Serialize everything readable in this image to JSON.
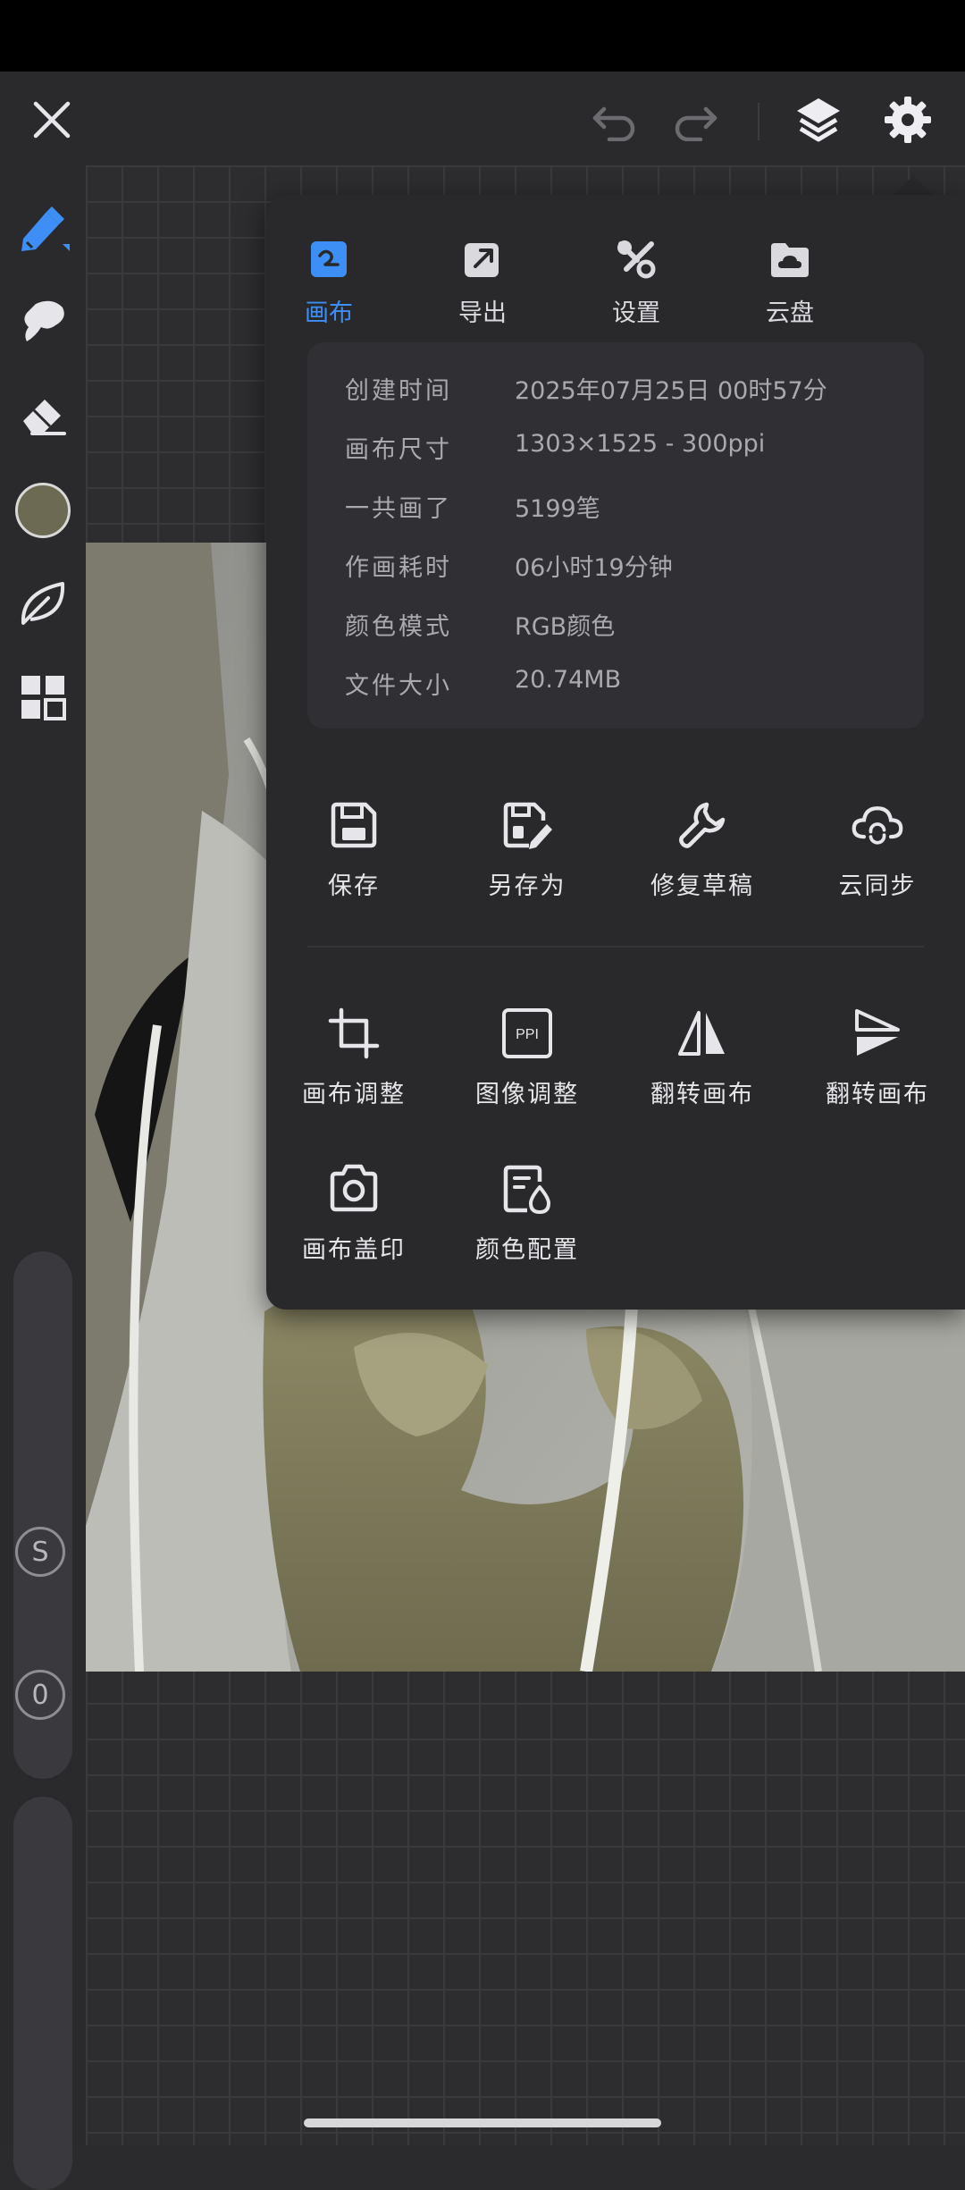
{
  "accent_color": "#3d8ff5",
  "toolbar": {
    "close_icon": "close-icon",
    "undo_icon": "undo-icon",
    "redo_icon": "redo-icon",
    "layers_icon": "layers-icon",
    "settings_icon": "gear-icon"
  },
  "left_rail": {
    "tools": [
      "pen-icon",
      "smudge-icon",
      "eraser-icon",
      "color-swatch",
      "leaf-icon",
      "grid-icon"
    ],
    "swatch_color": "#6c6a52",
    "size_slider_label": "S",
    "opacity_slider_label": "0"
  },
  "panel": {
    "tabs": [
      {
        "label": "画布",
        "icon": "canvas-tab-icon",
        "active": true
      },
      {
        "label": "导出",
        "icon": "export-icon",
        "active": false
      },
      {
        "label": "设置",
        "icon": "settings-tools-icon",
        "active": false
      },
      {
        "label": "云盘",
        "icon": "cloud-folder-icon",
        "active": false
      }
    ],
    "info": [
      {
        "key": "创建时间",
        "value": "2025年07月25日 00时57分"
      },
      {
        "key": "画布尺寸",
        "value": "1303×1525 - 300ppi"
      },
      {
        "key": "一共画了",
        "value": "5199笔"
      },
      {
        "key": "作画耗时",
        "value": "06小时19分钟"
      },
      {
        "key": "颜色模式",
        "value": "RGB颜色"
      },
      {
        "key": "文件大小",
        "value": "20.74MB"
      }
    ],
    "actions_row1": [
      {
        "label": "保存",
        "icon": "save-icon"
      },
      {
        "label": "另存为",
        "icon": "save-as-icon"
      },
      {
        "label": "修复草稿",
        "icon": "wrench-icon"
      },
      {
        "label": "云同步",
        "icon": "cloud-sync-icon"
      }
    ],
    "actions_row2": [
      {
        "label": "画布调整",
        "icon": "crop-icon"
      },
      {
        "label": "图像调整",
        "icon": "ppi-icon"
      },
      {
        "label": "翻转画布",
        "icon": "flip-horizontal-icon"
      },
      {
        "label": "翻转画布",
        "icon": "flip-vertical-icon"
      }
    ],
    "actions_row3": [
      {
        "label": "画布盖印",
        "icon": "camera-icon"
      },
      {
        "label": "颜色配置",
        "icon": "color-profile-icon"
      }
    ]
  }
}
